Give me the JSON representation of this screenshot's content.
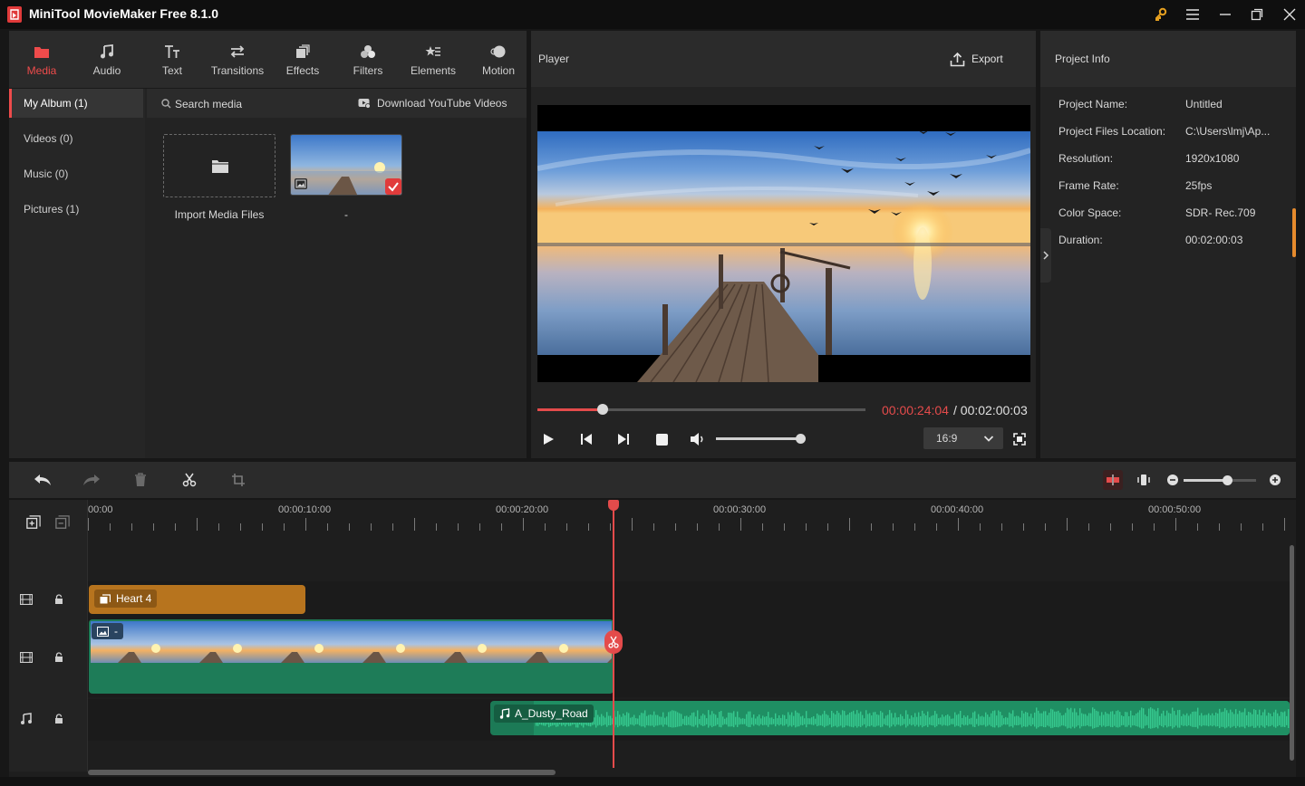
{
  "window": {
    "title": "MiniTool MovieMaker Free 8.1.0"
  },
  "colors": {
    "accent": "#ee4b4b",
    "title_clip": "#b7741e",
    "video_clip": "#1e7c58",
    "audio_clip": "#1c7a56",
    "scroll_accent": "#e58a2d"
  },
  "media_tabs": [
    {
      "label": "Media",
      "icon": "media-icon",
      "active": true
    },
    {
      "label": "Audio",
      "icon": "music-note-icon"
    },
    {
      "label": "Text",
      "icon": "text-icon"
    },
    {
      "label": "Transitions",
      "icon": "transitions-icon"
    },
    {
      "label": "Effects",
      "icon": "effects-icon"
    },
    {
      "label": "Filters",
      "icon": "filters-icon"
    },
    {
      "label": "Elements",
      "icon": "elements-icon"
    },
    {
      "label": "Motion",
      "icon": "motion-icon"
    }
  ],
  "album": [
    {
      "label": "My Album (1)",
      "active": true
    },
    {
      "label": "Videos (0)"
    },
    {
      "label": "Music (0)"
    },
    {
      "label": "Pictures (1)"
    }
  ],
  "media": {
    "search_placeholder": "Search media",
    "youtube_label": "Download YouTube Videos",
    "import_label": "Import Media Files",
    "thumb_label": "-"
  },
  "player": {
    "title": "Player",
    "export_label": "Export",
    "time_current": "00:00:24:04",
    "time_total": "/ 00:02:00:03",
    "progress": 0.2,
    "volume": 1.0,
    "aspect_ratio": "16:9"
  },
  "project_info": {
    "title": "Project Info",
    "rows": [
      {
        "label": "Project Name:",
        "value": "Untitled"
      },
      {
        "label": "Project Files Location:",
        "value": "C:\\Users\\lmj\\Ap..."
      },
      {
        "label": "Resolution:",
        "value": "1920x1080"
      },
      {
        "label": "Frame Rate:",
        "value": "25fps"
      },
      {
        "label": "Color Space:",
        "value": "SDR- Rec.709"
      },
      {
        "label": "Duration:",
        "value": "00:02:00:03"
      }
    ]
  },
  "timeline": {
    "ruler": [
      "00:00",
      "00:00:10:00",
      "00:00:20:00",
      "00:00:30:00",
      "00:00:40:00",
      "00:00:50:00"
    ],
    "zoom": 0.6,
    "clips": {
      "title_clip": "Heart 4",
      "video_clip": "-",
      "audio_clip": "A_Dusty_Road"
    }
  }
}
